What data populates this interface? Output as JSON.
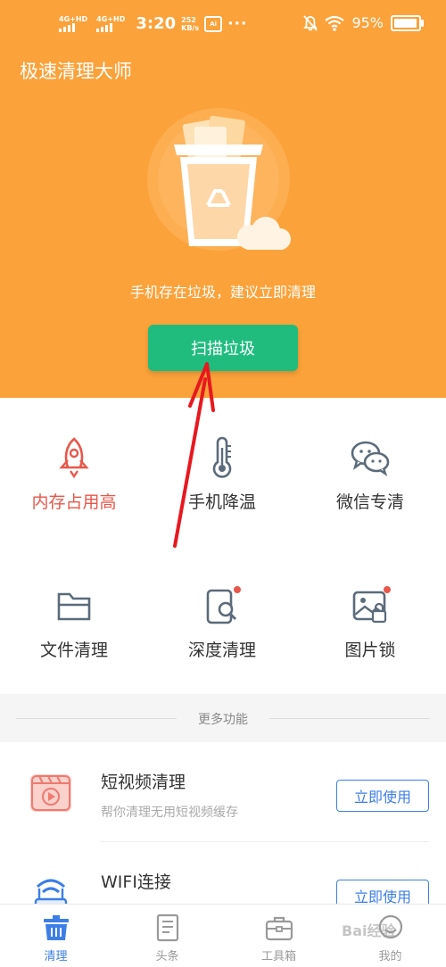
{
  "status_bar": {
    "network_1": "4G+HD",
    "network_2": "4G+HD",
    "time": "3:20",
    "speed_value": "252",
    "speed_unit": "KB/s",
    "battery": "95%",
    "battery_level": 0.95
  },
  "header": {
    "app_title": "极速清理大师"
  },
  "hero": {
    "message": "手机存在垃圾，建议立即清理",
    "scan_button": "扫描垃圾"
  },
  "tools": [
    {
      "label": "内存占用高",
      "icon": "rocket-icon"
    },
    {
      "label": "手机降温",
      "icon": "thermometer-icon"
    },
    {
      "label": "微信专清",
      "icon": "wechat-icon"
    },
    {
      "label": "文件清理",
      "icon": "folder-icon"
    },
    {
      "label": "深度清理",
      "icon": "deep-scan-icon"
    },
    {
      "label": "图片锁",
      "icon": "image-lock-icon"
    }
  ],
  "more": {
    "title": "更多功能",
    "items": [
      {
        "title": "短视频清理",
        "desc": "帮你清理无用短视频缓存",
        "button": "立即使用",
        "icon": "video-icon"
      },
      {
        "title": "WIFI连接",
        "desc": "",
        "button": "立即使用",
        "icon": "wifi-router-icon"
      }
    ]
  },
  "nav": {
    "items": [
      {
        "label": "清理",
        "icon": "clean-icon",
        "active": true
      },
      {
        "label": "头条",
        "icon": "news-icon",
        "active": false
      },
      {
        "label": "工具箱",
        "icon": "toolbox-icon",
        "active": false
      },
      {
        "label": "我的",
        "icon": "profile-icon",
        "active": false
      }
    ]
  },
  "watermark": "Bai经验",
  "colors": {
    "header_orange": "#fba23a",
    "scan_green": "#1fbc7e",
    "accent_blue": "#3c7ee6",
    "hot_red": "#e8574a",
    "annotation_red": "#e8181e"
  }
}
